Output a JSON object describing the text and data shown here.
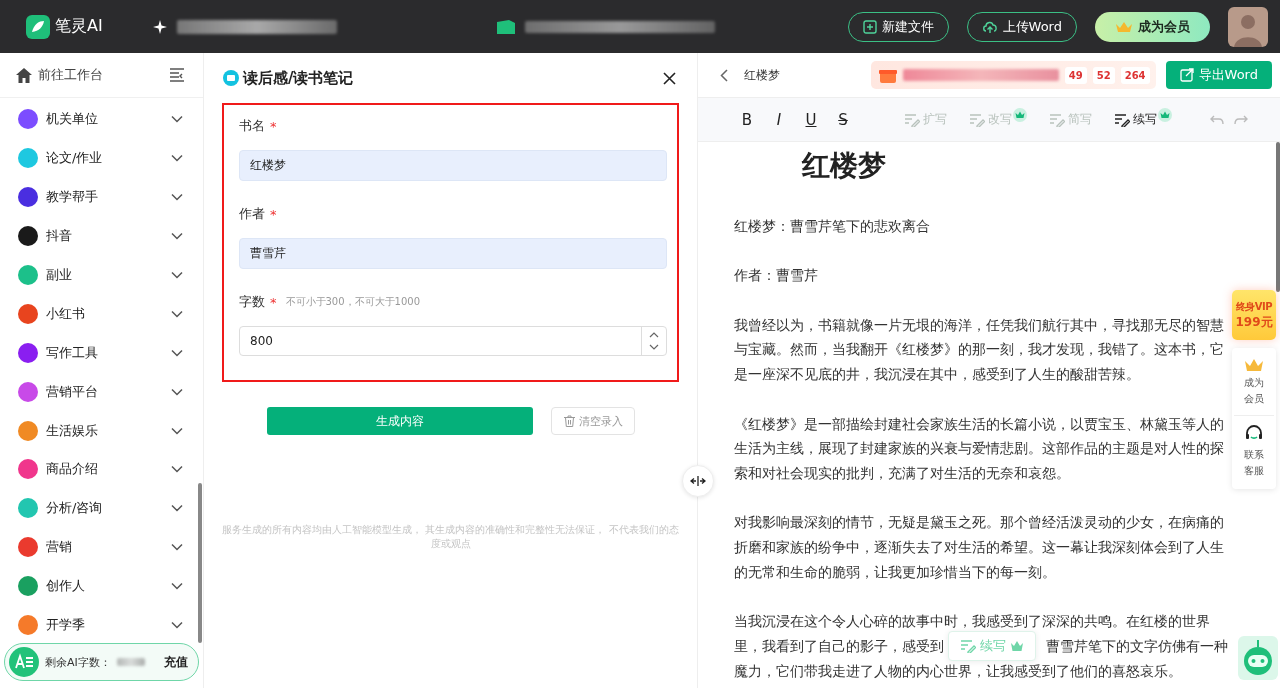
{
  "topbar": {
    "logo": "笔灵AI",
    "buttons": [
      {
        "kind": "new",
        "label": "新建文件"
      },
      {
        "kind": "upload",
        "label": "上传Word"
      },
      {
        "kind": "member",
        "label": "成为会员"
      }
    ]
  },
  "sidebar": {
    "workbench": "前往工作台",
    "items": [
      {
        "label": "机关单位",
        "color": "#7c4dff"
      },
      {
        "label": "论文/作业",
        "color": "#1ec8e0"
      },
      {
        "label": "教学帮手",
        "color": "#4a2ee0"
      },
      {
        "label": "抖音",
        "color": "#1a1a1a"
      },
      {
        "label": "副业",
        "color": "#1cc08a"
      },
      {
        "label": "小红书",
        "color": "#e8441e"
      },
      {
        "label": "写作工具",
        "color": "#8a1ef0"
      },
      {
        "label": "营销平台",
        "color": "#c84ae8"
      },
      {
        "label": "生活娱乐",
        "color": "#f08a24"
      },
      {
        "label": "商品介绍",
        "color": "#f0368c"
      },
      {
        "label": "分析/咨询",
        "color": "#22c6b0"
      },
      {
        "label": "营销",
        "color": "#ea3a2e"
      },
      {
        "label": "创作人",
        "color": "#1aa060"
      },
      {
        "label": "开学季",
        "color": "#f57a2a"
      }
    ],
    "quota": {
      "label": "剩余AI字数：",
      "action": "充值"
    }
  },
  "form": {
    "title": "读后感/读书笔记",
    "fields": [
      {
        "label": "书名",
        "required_mark": "*",
        "value": "红楼梦",
        "kind": "text"
      },
      {
        "label": "作者",
        "required_mark": "*",
        "value": "曹雪芹",
        "kind": "text"
      },
      {
        "label": "字数",
        "required_mark": "*",
        "hint": "不可小于300，不可大于1000",
        "value": "800",
        "kind": "number"
      }
    ],
    "generate": "生成内容",
    "clear": "清空录入",
    "disclaimer": "服务生成的所有内容均由人工智能模型生成， 其生成内容的准确性和完整性无法保证， 不代表我们的态度或观点"
  },
  "editor": {
    "doc_title": "红楼梦",
    "countdown": [
      "49",
      "52",
      "264"
    ],
    "export": "导出Word",
    "format_buttons": [
      {
        "label": "B",
        "kind": "bold"
      },
      {
        "label": "I",
        "kind": "italic"
      },
      {
        "label": "U",
        "kind": "underline"
      },
      {
        "label": "S",
        "kind": "strike"
      }
    ],
    "ai_tools": [
      {
        "label": "扩写",
        "disabled": true,
        "premium": false
      },
      {
        "label": "改写",
        "disabled": true,
        "premium": true
      },
      {
        "label": "简写",
        "disabled": true,
        "premium": false
      },
      {
        "label": "续写",
        "disabled": false,
        "premium": true
      }
    ],
    "heading": "红楼梦",
    "paragraphs": [
      "红楼梦：曹雪芹笔下的悲欢离合",
      "作者：曹雪芹",
      "我曾经以为，书籍就像一片无垠的海洋，任凭我们航行其中，寻找那无尽的智慧与宝藏。然而，当我翻开《红楼梦》的那一刻，我才发现，我错了。这本书，它是一座深不见底的井，我沉浸在其中，感受到了人生的酸甜苦辣。",
      "《红楼梦》是一部描绘封建社会家族生活的长篇小说，以贾宝玉、林黛玉等人的生活为主线，展现了封建家族的兴衰与爱情悲剧。这部作品的主题是对人性的探索和对社会现实的批判，充满了对生活的无奈和哀怨。",
      "对我影响最深刻的情节，无疑是黛玉之死。那个曾经活泼灵动的少女，在病痛的折磨和家族的纷争中，逐渐失去了对生活的希望。这一幕让我深刻体会到了人生的无常和生命的脆弱，让我更加珍惜当下的每一刻。"
    ],
    "last_paragraph": {
      "line_1": "当我沉浸在这个令人心碎的故事中时，我感受到了深深的共鸣。在红楼的世界",
      "line_2_start": "里，我看到了自己的影子，感受到",
      "line_2_end": "曹雪芹笔下的文字仿佛有一种",
      "line_3": "魔力，它们带我走进了人物的内心世界，让我感受到了他们的喜怒哀乐。"
    },
    "floating_continue": "续写"
  },
  "side_float": {
    "vip_title": "终身VIP",
    "vip_price": "199元",
    "member": "成为会员",
    "service": "联系客服"
  }
}
